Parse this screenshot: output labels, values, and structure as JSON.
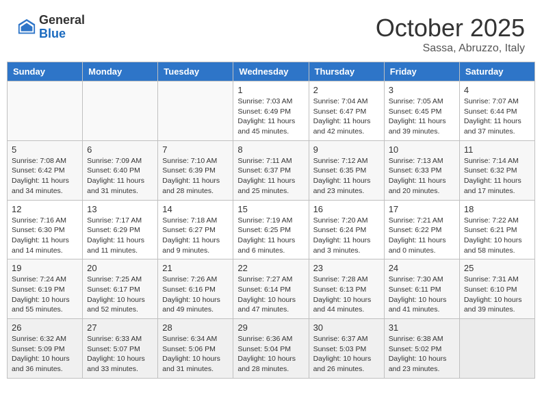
{
  "header": {
    "logo_general": "General",
    "logo_blue": "Blue",
    "month_title": "October 2025",
    "subtitle": "Sassa, Abruzzo, Italy"
  },
  "days_of_week": [
    "Sunday",
    "Monday",
    "Tuesday",
    "Wednesday",
    "Thursday",
    "Friday",
    "Saturday"
  ],
  "weeks": [
    {
      "days": [
        {
          "number": "",
          "info": "",
          "empty": true
        },
        {
          "number": "",
          "info": "",
          "empty": true
        },
        {
          "number": "",
          "info": "",
          "empty": true
        },
        {
          "number": "1",
          "info": "Sunrise: 7:03 AM\nSunset: 6:49 PM\nDaylight: 11 hours and 45 minutes.",
          "empty": false
        },
        {
          "number": "2",
          "info": "Sunrise: 7:04 AM\nSunset: 6:47 PM\nDaylight: 11 hours and 42 minutes.",
          "empty": false
        },
        {
          "number": "3",
          "info": "Sunrise: 7:05 AM\nSunset: 6:45 PM\nDaylight: 11 hours and 39 minutes.",
          "empty": false
        },
        {
          "number": "4",
          "info": "Sunrise: 7:07 AM\nSunset: 6:44 PM\nDaylight: 11 hours and 37 minutes.",
          "empty": false
        }
      ]
    },
    {
      "days": [
        {
          "number": "5",
          "info": "Sunrise: 7:08 AM\nSunset: 6:42 PM\nDaylight: 11 hours and 34 minutes.",
          "empty": false
        },
        {
          "number": "6",
          "info": "Sunrise: 7:09 AM\nSunset: 6:40 PM\nDaylight: 11 hours and 31 minutes.",
          "empty": false
        },
        {
          "number": "7",
          "info": "Sunrise: 7:10 AM\nSunset: 6:39 PM\nDaylight: 11 hours and 28 minutes.",
          "empty": false
        },
        {
          "number": "8",
          "info": "Sunrise: 7:11 AM\nSunset: 6:37 PM\nDaylight: 11 hours and 25 minutes.",
          "empty": false
        },
        {
          "number": "9",
          "info": "Sunrise: 7:12 AM\nSunset: 6:35 PM\nDaylight: 11 hours and 23 minutes.",
          "empty": false
        },
        {
          "number": "10",
          "info": "Sunrise: 7:13 AM\nSunset: 6:33 PM\nDaylight: 11 hours and 20 minutes.",
          "empty": false
        },
        {
          "number": "11",
          "info": "Sunrise: 7:14 AM\nSunset: 6:32 PM\nDaylight: 11 hours and 17 minutes.",
          "empty": false
        }
      ]
    },
    {
      "days": [
        {
          "number": "12",
          "info": "Sunrise: 7:16 AM\nSunset: 6:30 PM\nDaylight: 11 hours and 14 minutes.",
          "empty": false
        },
        {
          "number": "13",
          "info": "Sunrise: 7:17 AM\nSunset: 6:29 PM\nDaylight: 11 hours and 11 minutes.",
          "empty": false
        },
        {
          "number": "14",
          "info": "Sunrise: 7:18 AM\nSunset: 6:27 PM\nDaylight: 11 hours and 9 minutes.",
          "empty": false
        },
        {
          "number": "15",
          "info": "Sunrise: 7:19 AM\nSunset: 6:25 PM\nDaylight: 11 hours and 6 minutes.",
          "empty": false
        },
        {
          "number": "16",
          "info": "Sunrise: 7:20 AM\nSunset: 6:24 PM\nDaylight: 11 hours and 3 minutes.",
          "empty": false
        },
        {
          "number": "17",
          "info": "Sunrise: 7:21 AM\nSunset: 6:22 PM\nDaylight: 11 hours and 0 minutes.",
          "empty": false
        },
        {
          "number": "18",
          "info": "Sunrise: 7:22 AM\nSunset: 6:21 PM\nDaylight: 10 hours and 58 minutes.",
          "empty": false
        }
      ]
    },
    {
      "days": [
        {
          "number": "19",
          "info": "Sunrise: 7:24 AM\nSunset: 6:19 PM\nDaylight: 10 hours and 55 minutes.",
          "empty": false
        },
        {
          "number": "20",
          "info": "Sunrise: 7:25 AM\nSunset: 6:17 PM\nDaylight: 10 hours and 52 minutes.",
          "empty": false
        },
        {
          "number": "21",
          "info": "Sunrise: 7:26 AM\nSunset: 6:16 PM\nDaylight: 10 hours and 49 minutes.",
          "empty": false
        },
        {
          "number": "22",
          "info": "Sunrise: 7:27 AM\nSunset: 6:14 PM\nDaylight: 10 hours and 47 minutes.",
          "empty": false
        },
        {
          "number": "23",
          "info": "Sunrise: 7:28 AM\nSunset: 6:13 PM\nDaylight: 10 hours and 44 minutes.",
          "empty": false
        },
        {
          "number": "24",
          "info": "Sunrise: 7:30 AM\nSunset: 6:11 PM\nDaylight: 10 hours and 41 minutes.",
          "empty": false
        },
        {
          "number": "25",
          "info": "Sunrise: 7:31 AM\nSunset: 6:10 PM\nDaylight: 10 hours and 39 minutes.",
          "empty": false
        }
      ]
    },
    {
      "days": [
        {
          "number": "26",
          "info": "Sunrise: 6:32 AM\nSunset: 5:09 PM\nDaylight: 10 hours and 36 minutes.",
          "empty": false
        },
        {
          "number": "27",
          "info": "Sunrise: 6:33 AM\nSunset: 5:07 PM\nDaylight: 10 hours and 33 minutes.",
          "empty": false
        },
        {
          "number": "28",
          "info": "Sunrise: 6:34 AM\nSunset: 5:06 PM\nDaylight: 10 hours and 31 minutes.",
          "empty": false
        },
        {
          "number": "29",
          "info": "Sunrise: 6:36 AM\nSunset: 5:04 PM\nDaylight: 10 hours and 28 minutes.",
          "empty": false
        },
        {
          "number": "30",
          "info": "Sunrise: 6:37 AM\nSunset: 5:03 PM\nDaylight: 10 hours and 26 minutes.",
          "empty": false
        },
        {
          "number": "31",
          "info": "Sunrise: 6:38 AM\nSunset: 5:02 PM\nDaylight: 10 hours and 23 minutes.",
          "empty": false
        },
        {
          "number": "",
          "info": "",
          "empty": true
        }
      ]
    }
  ]
}
